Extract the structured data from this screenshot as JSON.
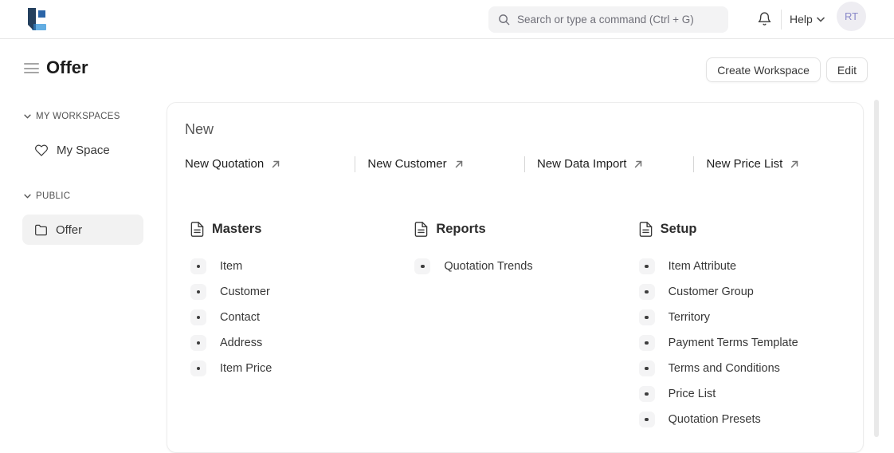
{
  "navbar": {
    "search_placeholder": "Search or type a command (Ctrl + G)",
    "help_label": "Help",
    "avatar_initials": "RT"
  },
  "header": {
    "title": "Offer",
    "create_workspace_label": "Create Workspace",
    "edit_label": "Edit"
  },
  "sidebar": {
    "sections": [
      {
        "label": "MY WORKSPACES",
        "items": [
          {
            "label": "My Space",
            "icon": "heart-icon",
            "selected": false
          }
        ]
      },
      {
        "label": "PUBLIC",
        "items": [
          {
            "label": "Offer",
            "icon": "folder-icon",
            "selected": true
          }
        ]
      }
    ]
  },
  "main": {
    "new_section": {
      "title": "New",
      "shortcuts": [
        {
          "label": "New Quotation",
          "icon": "arrow-up-right-icon"
        },
        {
          "label": "New Customer",
          "icon": "arrow-up-right-icon"
        },
        {
          "label": "New Data Import",
          "icon": "arrow-up-right-icon"
        },
        {
          "label": "New Price List",
          "icon": "arrow-up-right-icon"
        }
      ]
    },
    "columns": [
      {
        "title": "Masters",
        "icon": "document-icon",
        "items": [
          "Item",
          "Customer",
          "Contact",
          "Address",
          "Item Price"
        ]
      },
      {
        "title": "Reports",
        "icon": "document-icon",
        "items": [
          "Quotation Trends"
        ]
      },
      {
        "title": "Setup",
        "icon": "document-icon",
        "items": [
          "Item Attribute",
          "Customer Group",
          "Territory",
          "Payment Terms Template",
          "Terms and Conditions",
          "Price List",
          "Quotation Presets"
        ]
      }
    ]
  },
  "colors": {
    "logo_navy": "#24405E",
    "logo_light_blue": "#63ADE2",
    "logo_mid_blue": "#2B65A8",
    "logo_overlap": "#2E6DA6",
    "avatar_bg": "#EEEDF2",
    "avatar_text": "#8A89C9",
    "selected_item_bg": "#F2F2F2",
    "bullet_badge_bg": "#F4F4F5",
    "navbar_border": "#E7E7E7"
  }
}
